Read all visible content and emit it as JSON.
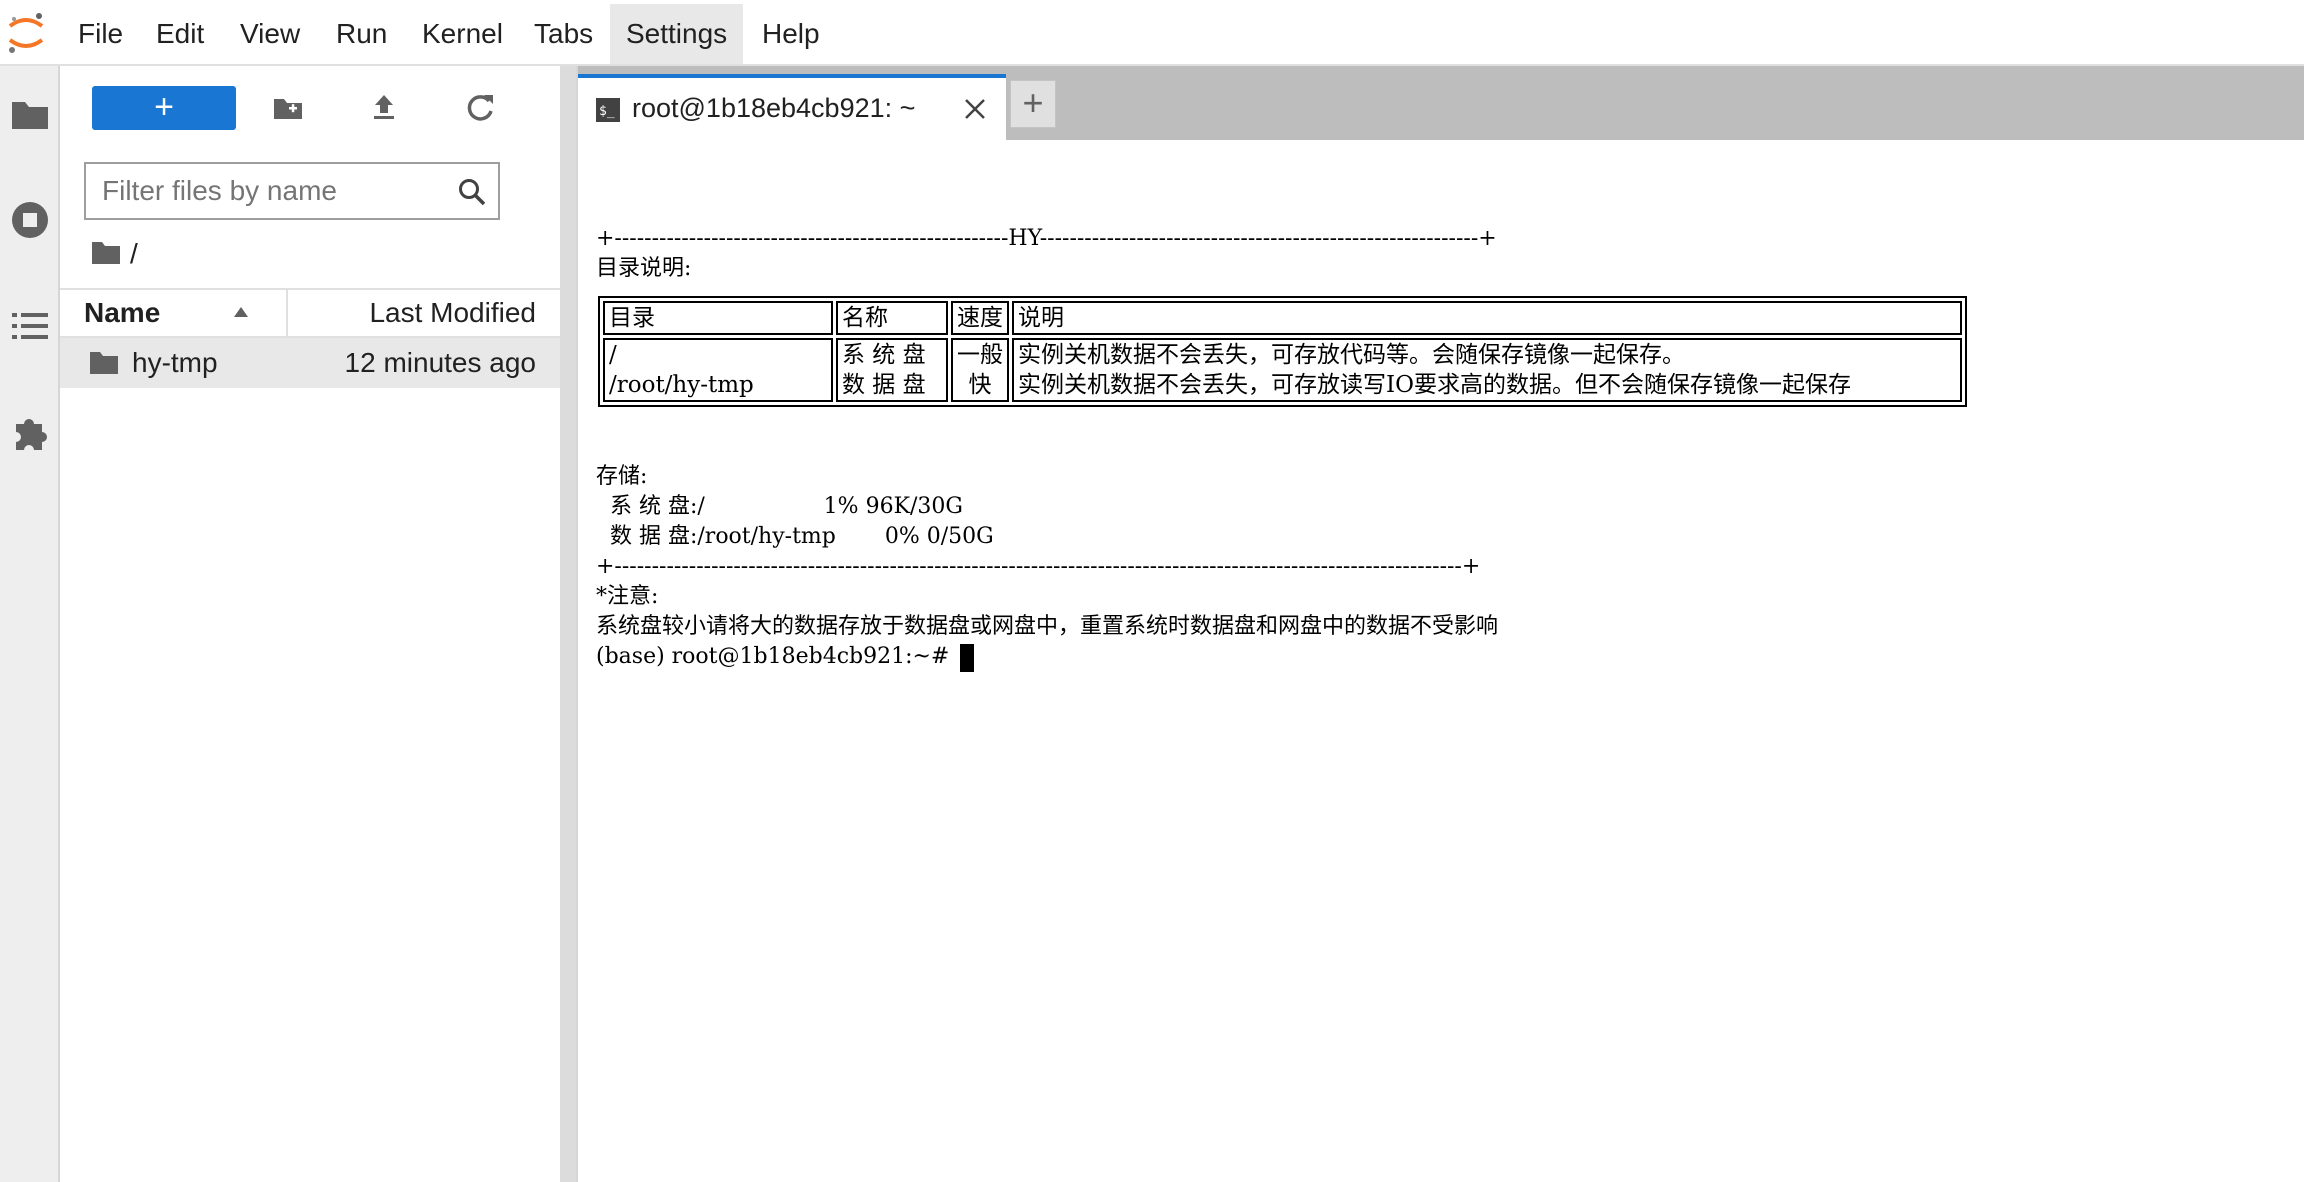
{
  "menu": {
    "items": [
      "File",
      "Edit",
      "View",
      "Run",
      "Kernel",
      "Tabs",
      "Settings",
      "Help"
    ],
    "active": "Settings"
  },
  "activity_bar": {
    "icons": [
      "folder-icon",
      "running-stop-icon",
      "table-of-contents-icon",
      "extension-puzzle-icon"
    ]
  },
  "file_browser": {
    "new_button_label": "+",
    "filter_placeholder": "Filter files by name",
    "breadcrumb": "/",
    "columns": {
      "name": "Name",
      "modified": "Last Modified"
    },
    "files": [
      {
        "name": "hy-tmp",
        "modified": "12 minutes ago",
        "type": "folder"
      }
    ]
  },
  "tabs": {
    "terminal_label": "root@1b18eb4cb921: ~",
    "add_label": "+"
  },
  "terminal": {
    "border_top": "+-----------------------------------------------------HY-----------------------------------------------------------+",
    "dir_heading": "目录说明:",
    "table_headers": [
      "目录",
      "名称",
      "速度",
      "说明"
    ],
    "table_rows": [
      [
        "/",
        "系 统 盘",
        "一般",
        "实例关机数据不会丢失，可存放代码等。会随保存镜像一起保存。"
      ],
      [
        "/root/hy-tmp",
        "数 据 盘",
        "快",
        "实例关机数据不会丢失，可存放读写IO要求高的数据。但不会随保存镜像一起保存"
      ]
    ],
    "storage_heading": "存储:",
    "storage_lines": [
      "  系 统 盘:/                 1% 96K/30G",
      "  数 据 盘:/root/hy-tmp       0% 0/50G"
    ],
    "border_bottom": "+------------------------------------------------------------------------------------------------------------------+",
    "note_heading": "*注意:",
    "note_text": "系统盘较小请将大的数据存放于数据盘或网盘中，重置系统时数据盘和网盘中的数据不受影响",
    "prompt": "(base) root@1b18eb4cb921:~# "
  },
  "colors": {
    "accent": "#1976d2",
    "tabbar": "#bdbdbd",
    "selected_row": "#e8e8e8"
  }
}
